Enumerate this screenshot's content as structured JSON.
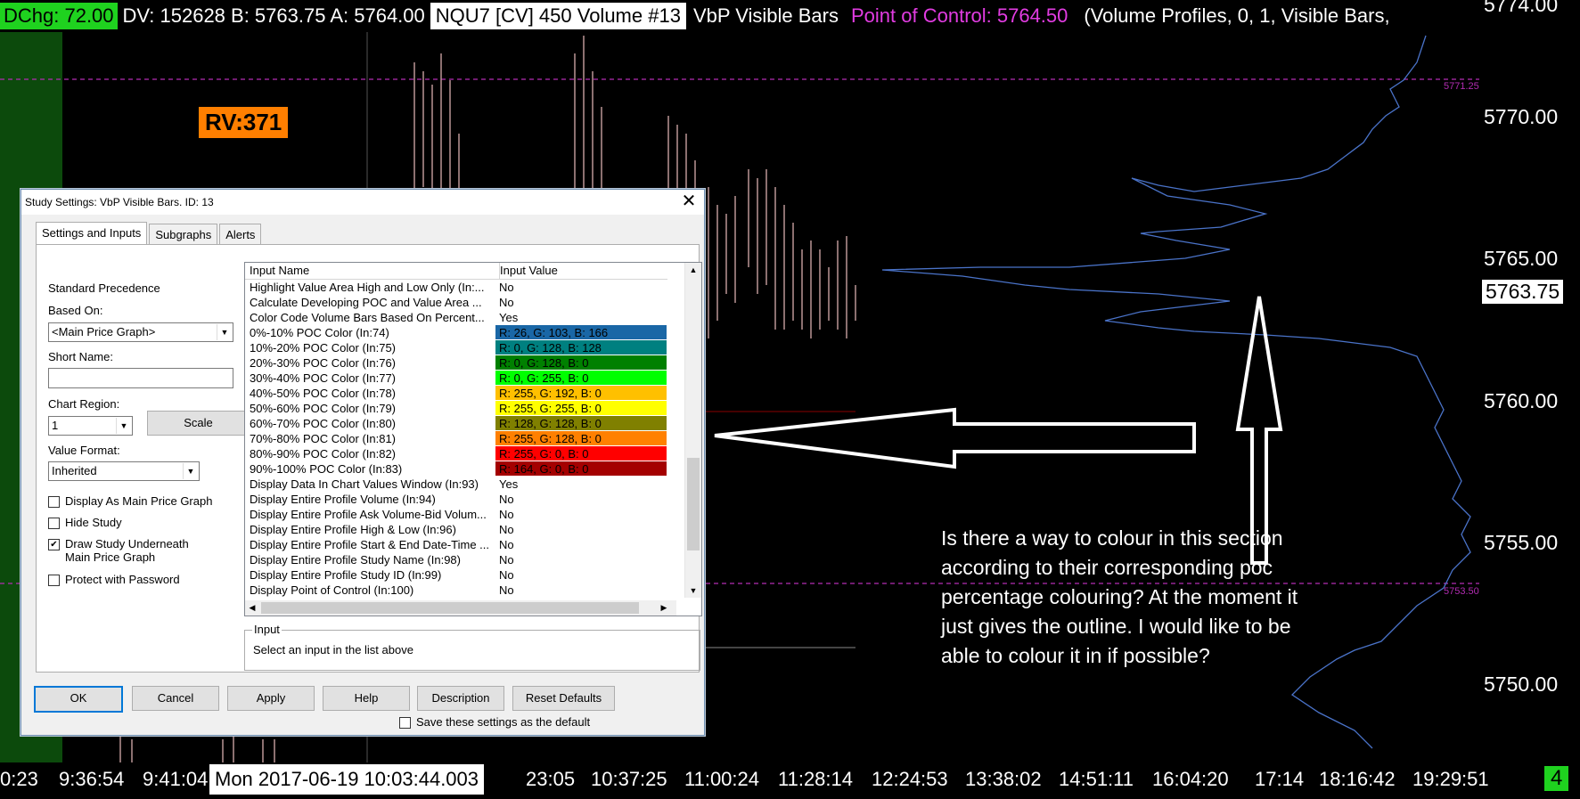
{
  "topbar": {
    "dchg": "DChg: 72.00",
    "dv": "DV: 152628 B: 5763.75 A: 5764.00",
    "symbol": "NQU7 [CV]  450 Volume  #13",
    "study": "VbP Visible Bars",
    "poc": "Point of Control: 5764.50",
    "vp": "(Volume Profiles, 0, 1, Visible Bars,"
  },
  "rv_badge": "RV:371",
  "price_axis": {
    "labels": [
      "5774.00",
      "5770.00",
      "5765.00",
      "5760.00",
      "5755.00",
      "5750.00"
    ],
    "current": "5763.75",
    "markers": [
      "5771.25",
      "5753.50"
    ]
  },
  "time_axis": {
    "labels": [
      "0:23",
      "9:36:54",
      "9:41:04",
      "23:05",
      "10:37:25",
      "11:00:24",
      "11:28:14",
      "12:24:53",
      "13:38:02",
      "14:51:11",
      "16:04:20",
      "17:14",
      "18:16:42",
      "19:29:51"
    ],
    "highlight": "Mon 2017-06-19  10:03:44.003"
  },
  "corner_number": "4",
  "annotation": "Is there a way to colour in this section according to their corresponding poc percentage colouring? At the moment it just gives the outline. I would like to be able to colour it in if possible?",
  "colors": {
    "chart_bg": "#000000",
    "green_highlight": "#1fd21f",
    "poc_magenta": "#e23ce2",
    "rv_orange": "#ff7f00",
    "dialog_bg": "#f0f0f0"
  },
  "dialog": {
    "title": "Study Settings: VbP Visible Bars. ID: 13",
    "close": "✕",
    "tabs": [
      "Settings and Inputs",
      "Subgraphs",
      "Alerts"
    ],
    "standard_precedence": "Standard Precedence",
    "based_on_label": "Based On:",
    "based_on_value": "<Main Price Graph>",
    "short_name_label": "Short Name:",
    "short_name_value": "",
    "chart_region_label": "Chart Region:",
    "chart_region_value": "1",
    "scale_button": "Scale",
    "value_format_label": "Value Format:",
    "value_format_value": "Inherited",
    "checkboxes": [
      {
        "label": "Display As Main Price Graph",
        "checked": false
      },
      {
        "label": "Hide Study",
        "checked": false
      },
      {
        "label": "Draw Study Underneath Main Price Graph",
        "checked": true
      },
      {
        "label": "Protect with Password",
        "checked": false
      }
    ],
    "grid": {
      "col_name": "Input Name",
      "col_value": "Input Value",
      "rows": [
        {
          "name": "Highlight Value Area High and Low Only  (In:...",
          "value": "No"
        },
        {
          "name": "Calculate Developing POC and Value Area  ...",
          "value": "No"
        },
        {
          "name": "Color Code Volume Bars Based On Percent...",
          "value": "Yes"
        },
        {
          "name": "0%-10% POC Color  (In:74)",
          "value": "R: 26, G: 103, B: 166",
          "color": "#1a67a6"
        },
        {
          "name": "10%-20% POC Color  (In:75)",
          "value": "R: 0, G: 128, B: 128",
          "color": "#008080"
        },
        {
          "name": "20%-30% POC Color  (In:76)",
          "value": "R: 0, G: 128, B: 0",
          "color": "#008000"
        },
        {
          "name": "30%-40% POC Color  (In:77)",
          "value": "R: 0, G: 255, B: 0",
          "color": "#00ff00"
        },
        {
          "name": "40%-50% POC Color  (In:78)",
          "value": "R: 255, G: 192, B: 0",
          "color": "#ffc000"
        },
        {
          "name": "50%-60% POC Color  (In:79)",
          "value": "R: 255, G: 255, B: 0",
          "color": "#ffff00"
        },
        {
          "name": "60%-70% POC Color  (In:80)",
          "value": "R: 128, G: 128, B: 0",
          "color": "#808000"
        },
        {
          "name": "70%-80% POC Color  (In:81)",
          "value": "R: 255, G: 128, B: 0",
          "color": "#ff8000"
        },
        {
          "name": "80%-90% POC Color  (In:82)",
          "value": "R: 255, G: 0, B: 0",
          "color": "#ff0000"
        },
        {
          "name": "90%-100% POC Color  (In:83)",
          "value": "R: 164, G: 0, B: 0",
          "color": "#a40000"
        },
        {
          "name": "Display Data In Chart Values Window  (In:93)",
          "value": "Yes"
        },
        {
          "name": "Display Entire Profile Volume  (In:94)",
          "value": "No"
        },
        {
          "name": "Display Entire Profile Ask Volume-Bid Volum...",
          "value": "No"
        },
        {
          "name": "Display Entire Profile High & Low  (In:96)",
          "value": "No"
        },
        {
          "name": "Display Entire Profile Start & End Date-Time ...",
          "value": "No"
        },
        {
          "name": "Display Entire Profile Study Name  (In:98)",
          "value": "No"
        },
        {
          "name": "Display Entire Profile Study ID  (In:99)",
          "value": "No"
        },
        {
          "name": "Display Point of Control  (In:100)",
          "value": "No"
        }
      ]
    },
    "input_group_title": "Input",
    "input_group_desc": "Select an input in the list above",
    "buttons": [
      "OK",
      "Cancel",
      "Apply",
      "Help",
      "Description",
      "Reset Defaults"
    ],
    "save_default_label": "Save these settings as the default"
  }
}
